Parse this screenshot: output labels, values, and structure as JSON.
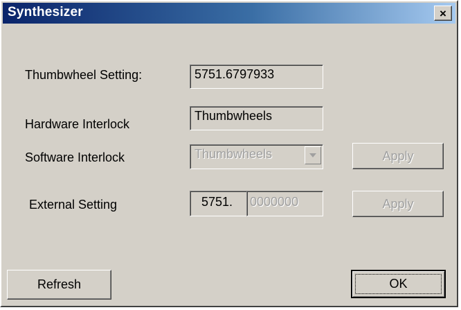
{
  "window": {
    "title": "Synthesizer",
    "close_glyph": "×",
    "close_icon": "close-icon"
  },
  "rows": {
    "thumbwheel": {
      "label": "Thumbwheel Setting:",
      "value": "5751.6797933"
    },
    "hardware": {
      "label": "Hardware Interlock",
      "value": "Thumbwheels"
    },
    "software": {
      "label": "Software Interlock",
      "selected": "Thumbwheels",
      "apply_label": "Apply",
      "dropdown_icon": "chevron-down-icon"
    },
    "external": {
      "label": "External Setting",
      "prefix": "5751.",
      "value": "0000000",
      "apply_label": "Apply"
    }
  },
  "buttons": {
    "refresh_label": "Refresh",
    "ok_label": "OK"
  },
  "colors": {
    "face": "#d4d0c8",
    "title_start": "#0a246a",
    "title_end": "#a6caf0",
    "disabled_text": "#a0a0a0"
  }
}
